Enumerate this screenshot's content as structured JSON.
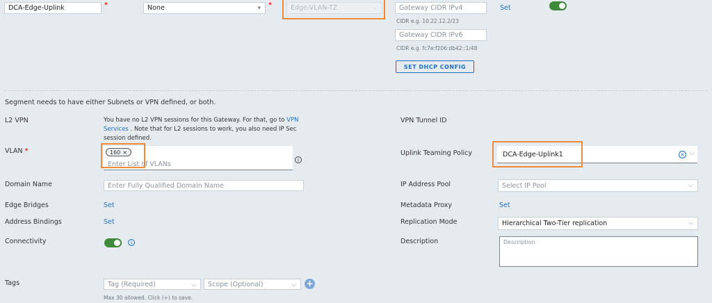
{
  "top": {
    "segment_name": "DCA-Edge-Uplink",
    "connected_gateway": "None",
    "transport_zone": "Edge-VLAN-TZ",
    "gateway_cidr_ipv4_placeholder": "Gateway CIDR IPv4",
    "cidr_ipv4_hint": "CIDR e.g. 10.22.12.2/23",
    "gateway_cidr_ipv6_placeholder": "Gateway CIDR IPv6",
    "cidr_ipv6_hint": "CIDR e.g. fc7e:f206:db42::1/48",
    "dhcp_button": "SET DHCP CONFIG",
    "set_link": "Set"
  },
  "notice": "Segment needs to have either Subnets or VPN defined, or both.",
  "left": {
    "l2vpn_label": "L2 VPN",
    "l2vpn_text_1": "You have no L2 VPN sessions for this Gateway. For that, go to",
    "l2vpn_link_1": "VPN",
    "l2vpn_link_2": "Services",
    "l2vpn_text_2": ". Note that for L2 sessions to work, you also need IP Sec",
    "l2vpn_text_3": "session defined.",
    "vlan_label": "VLAN",
    "vlan_chip": "160",
    "vlan_placeholder": "Enter List of VLANs",
    "domain_label": "Domain Name",
    "domain_placeholder": "Enter Fully Qualified Domain Name",
    "edge_bridges_label": "Edge Bridges",
    "edge_bridges_value": "Set",
    "address_bindings_label": "Address Bindings",
    "address_bindings_value": "Set",
    "connectivity_label": "Connectivity",
    "tags_label": "Tags",
    "tag_placeholder": "Tag (Required)",
    "scope_placeholder": "Scope (Optional)",
    "tags_hint": "Max 30 allowed. Click (+) to save."
  },
  "right": {
    "vpn_tunnel_label": "VPN Tunnel ID",
    "uplink_label": "Uplink Teaming Policy",
    "uplink_value": "DCA-Edge-Uplink1",
    "ip_pool_label": "IP Address Pool",
    "ip_pool_placeholder": "Select IP Pool",
    "metadata_label": "Metadata Proxy",
    "metadata_value": "Set",
    "replication_label": "Replication Mode",
    "replication_value": "Hierarchical Two-Tier replication",
    "description_label": "Description",
    "description_placeholder": "Description"
  },
  "colors": {
    "background": "#e6ebf0",
    "link": "#1f6fbf",
    "toggle_on": "#3f8a3a",
    "highlight": "#ee8a3a",
    "required": "#d9332b"
  }
}
